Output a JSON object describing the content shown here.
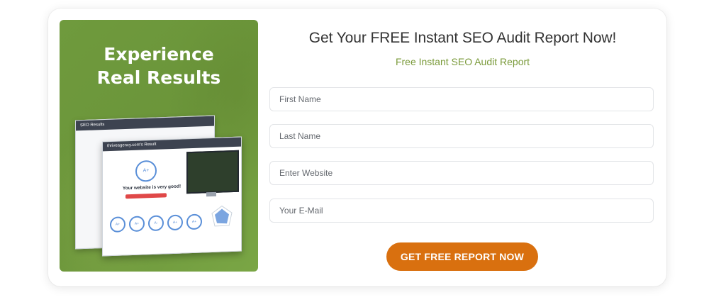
{
  "promo": {
    "heading_line1": "Experience",
    "heading_line2": "Real Results",
    "back_screenshot_title": "SEO Results",
    "front_screenshot_title": "thriveagency.com's Result",
    "grade": "A+",
    "verdict": "Your website is very good!",
    "small_grades": [
      "A+",
      "A+",
      "A-",
      "A+",
      "A+"
    ],
    "background_color": "#6f9a3d"
  },
  "form": {
    "title": "Get Your FREE Instant SEO Audit Report Now!",
    "subtitle": "Free Instant SEO Audit Report",
    "subtitle_color": "#7a9a3a",
    "fields": [
      {
        "name": "first-name",
        "placeholder": "First Name",
        "value": ""
      },
      {
        "name": "last-name",
        "placeholder": "Last Name",
        "value": ""
      },
      {
        "name": "website",
        "placeholder": "Enter Website",
        "value": ""
      },
      {
        "name": "email",
        "placeholder": "Your E-Mail",
        "value": ""
      }
    ],
    "submit_label": "GET FREE REPORT NOW",
    "submit_color": "#d9700f"
  }
}
